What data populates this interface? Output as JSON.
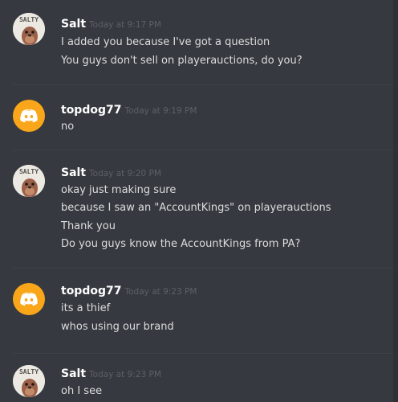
{
  "messages": [
    {
      "author": "Salt",
      "avatar": "salt-avatar",
      "timestamp": "Today at 9:17 PM",
      "lines": [
        "I added you because I've got a question",
        "You guys don't sell on playerauctions, do you?"
      ]
    },
    {
      "author": "topdog77",
      "avatar": "discord-logo-icon",
      "timestamp": "Today at 9:19 PM",
      "lines": [
        "no"
      ]
    },
    {
      "author": "Salt",
      "avatar": "salt-avatar",
      "timestamp": "Today at 9:20 PM",
      "lines": [
        "okay just making sure",
        "because I saw an \"AccountKings\" on playerauctions",
        "Thank you",
        "Do you guys know the AccountKings from PA?"
      ]
    },
    {
      "author": "topdog77",
      "avatar": "discord-logo-icon",
      "timestamp": "Today at 9:23 PM",
      "lines": [
        "its a thief",
        "whos using our brand"
      ]
    },
    {
      "author": "Salt",
      "avatar": "salt-avatar",
      "timestamp": "Today at 9:23 PM",
      "lines": [
        "oh I see"
      ]
    }
  ],
  "avatar_text": {
    "salt": "SALTY"
  },
  "colors": {
    "background": "#36393f",
    "discord_avatar": "#faa61a",
    "username": "#ffffff",
    "message_text": "#dcddde",
    "timestamp": "#5d6067"
  }
}
